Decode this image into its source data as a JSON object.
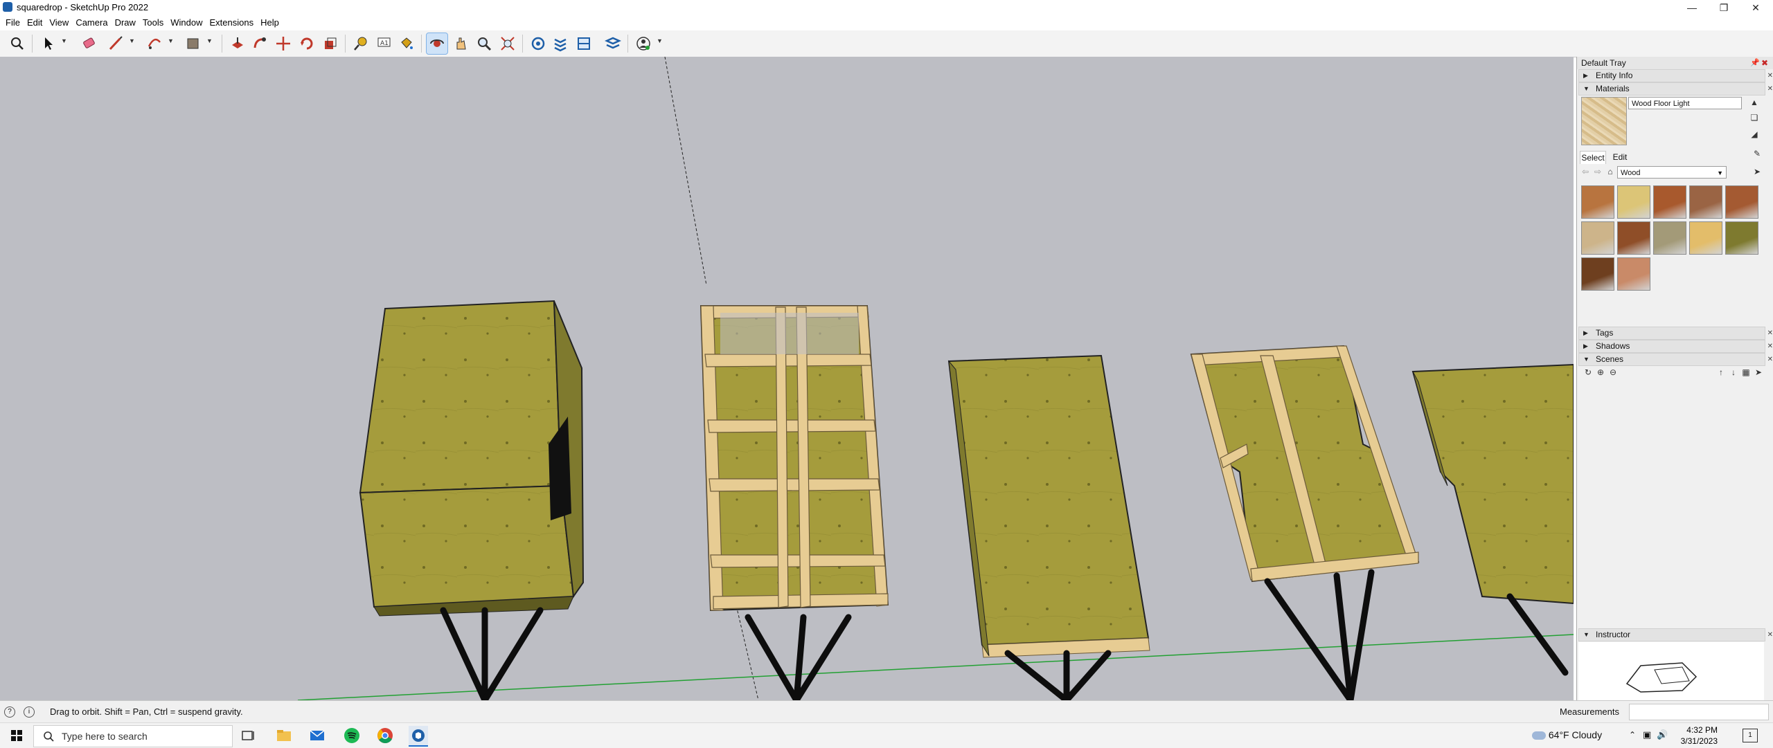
{
  "window": {
    "title": "squaredrop - SketchUp Pro 2022"
  },
  "menu": [
    "File",
    "Edit",
    "View",
    "Camera",
    "Draw",
    "Tools",
    "Window",
    "Extensions",
    "Help"
  ],
  "tray": {
    "title": "Default Tray",
    "panels": {
      "entity_info": "Entity Info",
      "materials": "Materials",
      "tags": "Tags",
      "shadows": "Shadows",
      "scenes": "Scenes",
      "instructor": "Instructor"
    },
    "material_name": "Wood Floor Light",
    "tabs": {
      "select": "Select",
      "edit": "Edit"
    },
    "library": "Wood",
    "swatches": [
      "#b8743f",
      "#dcc577",
      "#a8592d",
      "#9a6444",
      "#a45a32",
      "#cdb48a",
      "#8f4e28",
      "#a39a78",
      "#e3bd6a",
      "#7e7a2f",
      "#6e3f1f",
      "#c98a68"
    ]
  },
  "status": {
    "hint": "Drag to orbit. Shift = Pan, Ctrl = suspend gravity.",
    "measurements_label": "Measurements"
  },
  "taskbar": {
    "search_placeholder": "Type here to search",
    "weather": "64°F  Cloudy",
    "time": "4:32 PM",
    "date": "3/31/2023"
  },
  "colors": {
    "plywood": "#a59c3c",
    "plywood_dark": "#857f2e",
    "frame_wood": "#e7cc93",
    "sky": "#bdbec4",
    "axis_green": "#22a033"
  }
}
